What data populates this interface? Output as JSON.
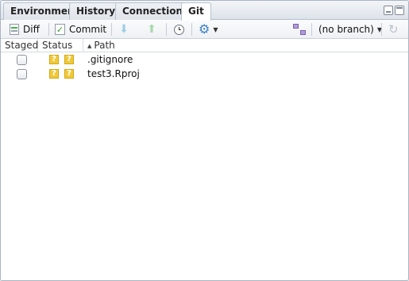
{
  "tabs": [
    {
      "label": "Environment",
      "active": false
    },
    {
      "label": "History",
      "active": false
    },
    {
      "label": "Connections",
      "active": false
    },
    {
      "label": "Git",
      "active": true
    }
  ],
  "toolbar": {
    "diff_label": "Diff",
    "commit_label": "Commit",
    "branch_label": "(no branch)"
  },
  "columns": {
    "staged": "Staged",
    "status": "Status",
    "path": "Path"
  },
  "files": [
    {
      "staged": false,
      "status_index": "?",
      "status_worktree": "?",
      "path": ".gitignore"
    },
    {
      "staged": false,
      "status_index": "?",
      "status_worktree": "?",
      "path": "test3.Rproj"
    }
  ],
  "colors": {
    "untracked_badge": "#f0c93a",
    "gear": "#3a7fc4"
  }
}
